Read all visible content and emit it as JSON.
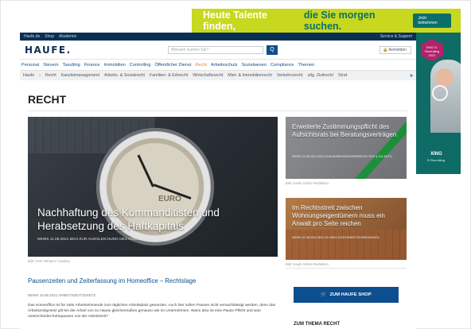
{
  "ad_top": {
    "text_white": "Heute Talente finden,",
    "text_teal": "die Sie morgen suchen.",
    "button": "Jetzt teilnehmen"
  },
  "ad_right": {
    "badge": "XING E-Recruiting 2021",
    "brand": "XING",
    "sub": "E-Recruiting"
  },
  "topstrip": {
    "left": [
      "Haufe.de",
      "Shop",
      "Akademie"
    ],
    "right": "Service & Support"
  },
  "header": {
    "logo": "HAUFE.",
    "search_placeholder": "Wonach suchen Sie?",
    "search_button": "Q",
    "login": "Anmelden"
  },
  "nav_primary": [
    "Personal",
    "Steuern",
    "Taxulting",
    "Finance",
    "Immobilien",
    "Controlling",
    "Öffentlicher Dienst",
    "Recht",
    "Arbeitsschutz",
    "Sozialwesen",
    "Compliance",
    "Themen"
  ],
  "nav_active": "Recht",
  "nav_secondary": [
    "Haufe",
    "Recht",
    "Kanzleimanagement",
    "Arbeits- & Sozialrecht",
    "Familien- & Erbrecht",
    "Wirtschaftsrecht",
    "Miet- & Immobilienrecht",
    "Verkehrsrecht",
    "allg. Zivilrecht",
    "Straf"
  ],
  "page": {
    "title": "RECHT"
  },
  "hero": {
    "title": "Nachhaftung des Kommanditisten und Herabsetzung des Haftkapitals",
    "meta": "NEWS  11.08.2021  BGH ZUR AUSGLEICHUNG DES KOMMANDITISTEN",
    "clock_text": "EURO",
    "caption": "Bild: Gerri Altmann / pixabay"
  },
  "teasers": [
    {
      "title": "Erweiterte Zustimmungspflicht des Aufsichtsrats bei Beratungsverträgen",
      "meta": "NEWS  11.08.2021  BGH ZUM ANWENDUNGSBEREICH DES § 114 AKTG",
      "caption": "Bild: Haufe Online Redaktion"
    },
    {
      "title": "Im Rechtsstreit zwischen Wohnungseigentümern muss ein Anwalt pro Seite reichen",
      "meta": "NEWS  10.08.2021  BGH ZU WEG-KOSTENENTSCHEIDUNGEN",
      "caption": "Bild: Haufe Online Redaktion"
    }
  ],
  "article": {
    "title": "Pausenzeiten und Zeiterfassung im Homeoffice – Rechtslage",
    "meta": "NEWS  16.08.2021  ARBEITSZEITGESETZ",
    "body": "Das Homeoffice ist für viele Arbeitnehmende zum täglichen Arbeitsplatz geworden. Auch hier sollen Pausen nicht vernachlässigt werden, denn das Arbeitszeitgesetz gilt bei der Arbeit von zu Hause gleichermaßen genauso wie im Unternehmen. Wann also ist eine Pause Pflicht und was unterscheidet Ruhepausen von der Arbeitszeit?"
  },
  "sidebar": {
    "shop_button": "ZUM HAUFE SHOP",
    "section_label": "ZUM THEMA RECHT"
  }
}
